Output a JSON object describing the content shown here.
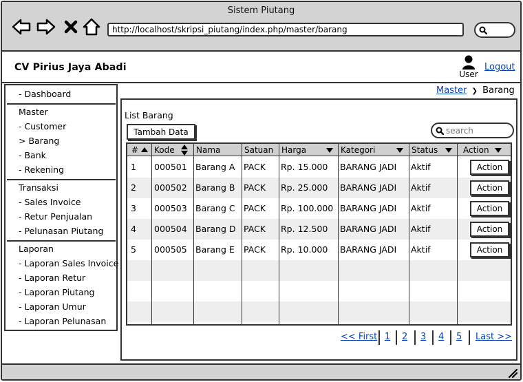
{
  "window": {
    "title": "Sistem Piutang"
  },
  "browser": {
    "url": "http://localhost/skripsi_piutang/index.php/master/barang",
    "icons": [
      "back-arrow-icon",
      "forward-arrow-icon",
      "close-x-icon",
      "home-icon",
      "search-icon"
    ]
  },
  "header": {
    "brand": "CV Pirius Jaya Abadi",
    "user_label": "User",
    "logout_label": "Logout"
  },
  "sidebar": {
    "dashboard": "- Dashboard",
    "master": {
      "heading": "Master",
      "items": [
        "- Customer",
        "> Barang",
        "- Bank",
        "- Rekening"
      ]
    },
    "transaksi": {
      "heading": "Transaksi",
      "items": [
        "- Sales Invoice",
        "- Retur Penjualan",
        "- Pelunasan Piutang"
      ]
    },
    "laporan": {
      "heading": "Laporan",
      "items": [
        "- Laporan Sales Invoice",
        "- Laporan Retur",
        "- Laporan Piutang",
        "- Laporan Umur",
        "- Laporan Pelunasan"
      ]
    }
  },
  "breadcrumb": {
    "parent": "Master",
    "separator": "❯",
    "current": "Barang"
  },
  "main": {
    "list_title": "List Barang",
    "add_button": "Tambah Data",
    "search_placeholder": "search"
  },
  "table": {
    "headers": [
      "#",
      "Kode",
      "Nama",
      "Satuan",
      "Harga",
      "Kategori",
      "Status",
      "Action"
    ],
    "rows": [
      [
        "1",
        "000501",
        "Barang A",
        "PACK",
        "Rp. 15.000",
        "BARANG JADI",
        "Aktif",
        "Action"
      ],
      [
        "2",
        "000502",
        "Barang B",
        "PACK",
        "Rp. 25.000",
        "BARANG JADI",
        "Aktif",
        "Action"
      ],
      [
        "3",
        "000503",
        "Barang C",
        "PACK",
        "Rp. 100.000",
        "BARANG JADI",
        "Aktif",
        "Action"
      ],
      [
        "4",
        "000504",
        "Barang D",
        "PACK",
        "Rp. 12.500",
        "BARANG JADI",
        "Aktif",
        "Action"
      ],
      [
        "5",
        "000505",
        "Barang E",
        "PACK",
        "Rp. 10.000",
        "BARANG JADI",
        "Aktif",
        "Action"
      ]
    ]
  },
  "pagination": {
    "first": "<< First",
    "pages": [
      "1",
      "2",
      "3",
      "4",
      "5"
    ],
    "last": "Last >>"
  },
  "colors": {
    "chrome": "#d3d3d3",
    "link": "#0645ad",
    "table_header": "#d0d0d0",
    "row_alt": "#eeeeee",
    "border": "#333333"
  }
}
